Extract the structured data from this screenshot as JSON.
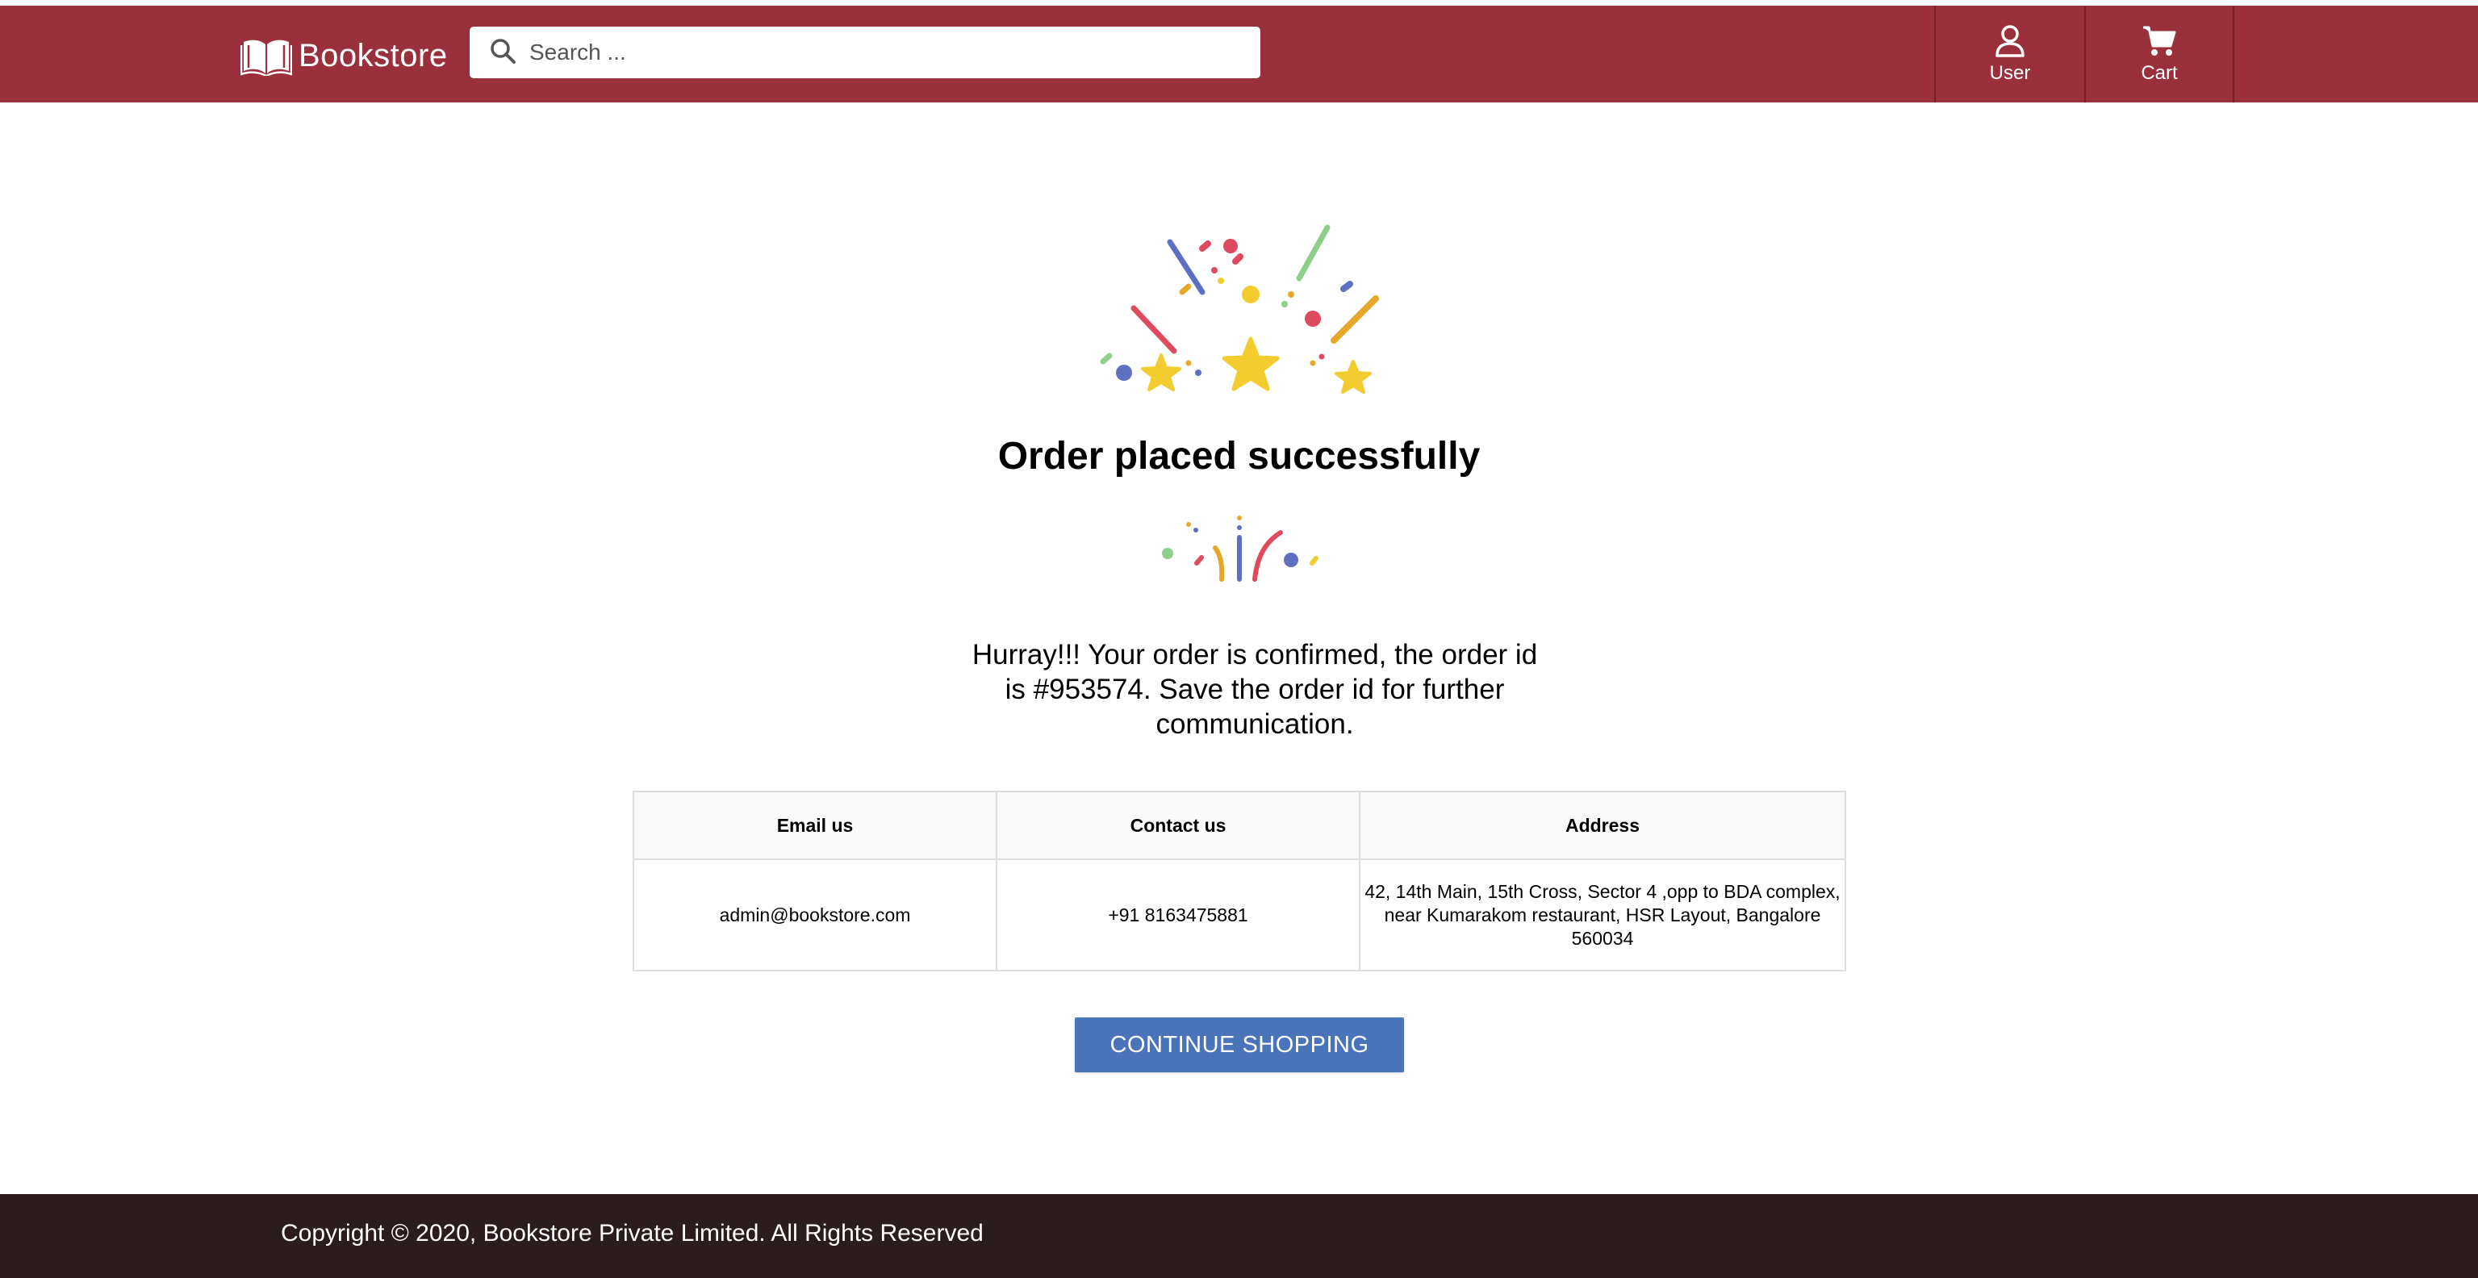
{
  "header": {
    "brand_name": "Bookstore",
    "search_placeholder": "Search ...",
    "nav": {
      "user_label": "User",
      "cart_label": "Cart"
    }
  },
  "main": {
    "title": "Order placed successfully",
    "message": "Hurray!!! Your order is confirmed, the order id is #953574. Save the order id for further communication.",
    "table": {
      "headers": [
        "Email us",
        "Contact us",
        "Address"
      ],
      "row": [
        "admin@bookstore.com",
        "+91 8163475881",
        "42, 14th Main, 15th Cross, Sector 4 ,opp to BDA complex, near Kumarakom restaurant, HSR Layout, Bangalore 560034"
      ]
    },
    "continue_label": "CONTINUE SHOPPING"
  },
  "footer": {
    "copyright": "Copyright © 2020, Bookstore Private Limited. All Rights Reserved"
  },
  "colors": {
    "navbar": "#99303b",
    "button": "#4a74b9",
    "footer": "#2b1c1e",
    "confetti_red": "#de4b5e",
    "confetti_blue": "#5f6fc2",
    "confetti_green": "#8ed08a",
    "confetti_yellow": "#f3cd2f",
    "confetti_orange": "#e7a82a"
  },
  "icons": {
    "brand": "open-book-icon",
    "search": "search-icon",
    "user": "user-icon",
    "cart": "cart-icon",
    "celebration": "confetti-stars-icon"
  }
}
